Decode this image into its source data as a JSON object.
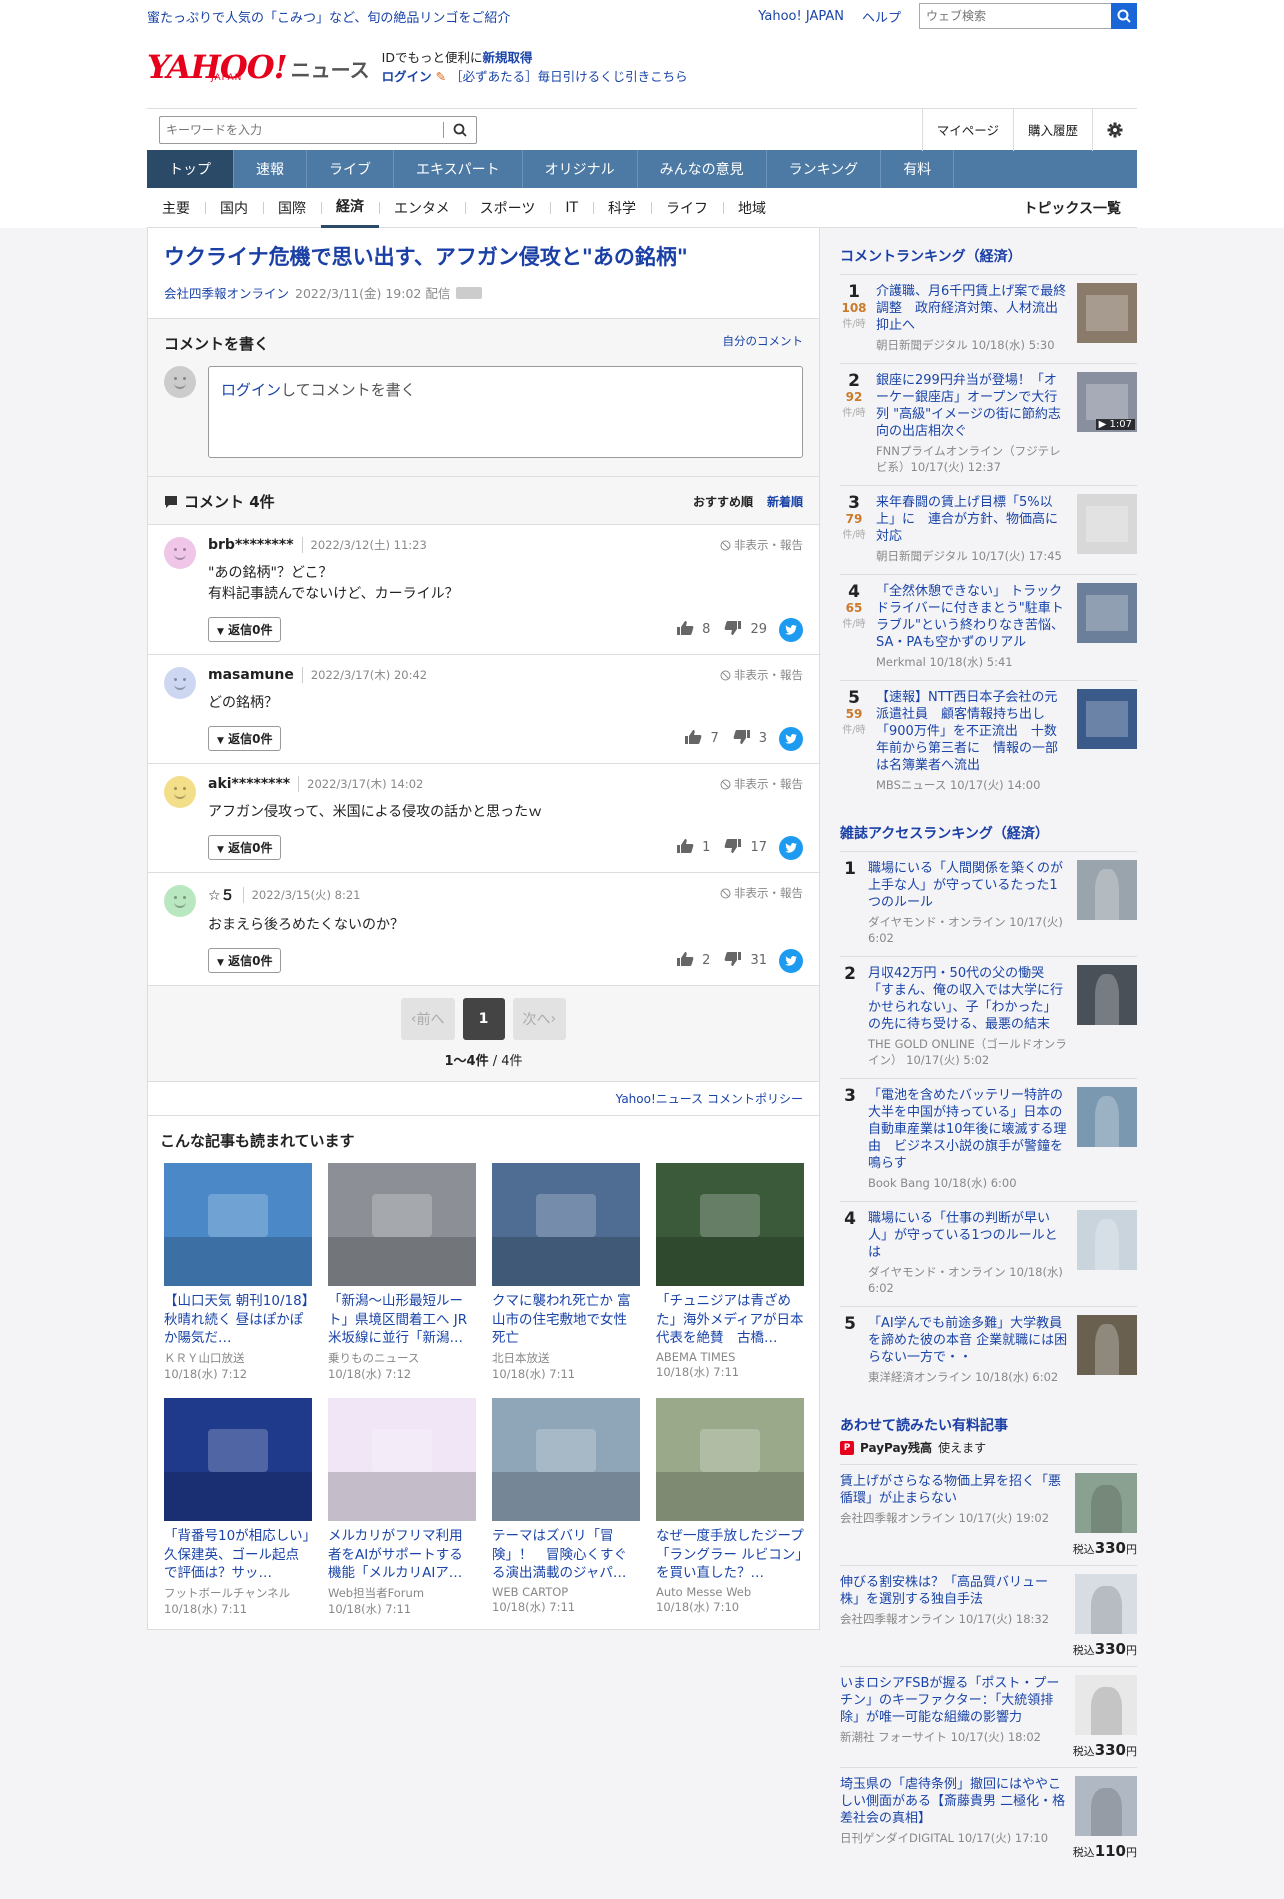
{
  "promo": {
    "ad_text": "蜜たっぷりで人気の「こみつ」など、旬の絶品リンゴをご紹介",
    "yj_link": "Yahoo! JAPAN",
    "help_link": "ヘルプ",
    "web_search_placeholder": "ウェブ検索"
  },
  "header": {
    "logo_text": "YAHOO!",
    "logo_sub": "JAPAN",
    "logo_news": "ニュース",
    "id_line_prefix": "IDでもっと便利に",
    "id_signup": "新規取得",
    "login": "ログイン",
    "lottery": "［必ずあたる］毎日引けるくじ引きこちら"
  },
  "searchbar": {
    "placeholder": "キーワードを入力",
    "mypage": "マイページ",
    "history": "購入履歴"
  },
  "nav_main": [
    "トップ",
    "速報",
    "ライブ",
    "エキスパート",
    "オリジナル",
    "みんなの意見",
    "ランキング",
    "有料"
  ],
  "nav_sub": [
    "主要",
    "国内",
    "国際",
    "経済",
    "エンタメ",
    "スポーツ",
    "IT",
    "科学",
    "ライフ",
    "地域"
  ],
  "nav_topics": "トピックス一覧",
  "article": {
    "title": "ウクライナ危機で思い出す、アフガン侵攻と\"あの銘柄\"",
    "source": "会社四季報オンライン",
    "date": "2022/3/11(金) 19:02 配信"
  },
  "comment_write": {
    "heading": "コメントを書く",
    "my_comments": "自分のコメント",
    "login_link": "ログイン",
    "prompt": "してコメントを書く"
  },
  "comments_header": {
    "title": "コメント 4件",
    "sort_recommended": "おすすめ順",
    "sort_new": "新着順"
  },
  "comments": [
    {
      "user": "brb********",
      "date": "2022/3/12(土) 11:23",
      "hide": "非表示・報告",
      "text1": "\"あの銘柄\"？どこ？",
      "text2": "有料記事読んでないけど、カーライル？",
      "reply": "返信0件",
      "good": "8",
      "bad": "29",
      "color": "#f0c6e8"
    },
    {
      "user": "masamune",
      "date": "2022/3/17(木) 20:42",
      "hide": "非表示・報告",
      "text1": "どの銘柄？",
      "text2": "",
      "reply": "返信0件",
      "good": "7",
      "bad": "3",
      "color": "#cdd7f2"
    },
    {
      "user": "aki********",
      "date": "2022/3/17(木) 14:02",
      "hide": "非表示・報告",
      "text1": "アフガン侵攻って、米国による侵攻の話かと思ったｗ",
      "text2": "",
      "reply": "返信0件",
      "good": "1",
      "bad": "17",
      "color": "#f3de8a"
    },
    {
      "user": "☆５",
      "date": "2022/3/15(火) 8:21",
      "hide": "非表示・報告",
      "text1": "おまえら後ろめたくないのか？",
      "text2": "",
      "reply": "返信0件",
      "good": "2",
      "bad": "31",
      "color": "#b9e8c0"
    }
  ],
  "pagination": {
    "prev": "前へ",
    "current": "1",
    "next": "次へ",
    "count": "1〜4件",
    "total": " / 4件"
  },
  "policy": "Yahoo!ニュース コメントポリシー",
  "related": {
    "heading": "こんな記事も読まれています",
    "items": [
      {
        "title": "【山口天気 朝刊10/18】秋晴れ続く 昼はぽかぽか陽気だ…",
        "src": "ＫＲＹ山口放送",
        "date": "10/18(水) 7:12",
        "bg": "#4a88c8"
      },
      {
        "title": "「新潟～山形最短ルート」県境区間着工へ JR米坂線に並行「新潟…",
        "src": "乗りものニュース",
        "date": "10/18(水) 7:12",
        "bg": "#8c9096"
      },
      {
        "title": "クマに襲われ死亡か 富山市の住宅敷地で女性死亡",
        "src": "北日本放送",
        "date": "10/18(水) 7:11",
        "bg": "#4f6d92"
      },
      {
        "title": "「チュニジアは青ざめた」海外メディアが日本代表を絶賛　古橋…",
        "src": "ABEMA TIMES",
        "date": "10/18(水) 7:11",
        "bg": "#3a5a3a"
      },
      {
        "title": "「背番号10が相応しい」久保建英、ゴール起点で評価は？サッ…",
        "src": "フットボールチャンネル",
        "date": "10/18(水) 7:11",
        "bg": "#1f3a8a"
      },
      {
        "title": "メルカリがフリマ利用者をAIがサポートする機能「メルカリAIア…",
        "src": "Web担当者Forum",
        "date": "10/18(水) 7:11",
        "bg": "#f1e6f6"
      },
      {
        "title": "テーマはズバリ「冒険」！　冒険心くすぐる演出満載のジャパ…",
        "src": "WEB CARTOP",
        "date": "10/18(水) 7:11",
        "bg": "#8fa5b8"
      },
      {
        "title": "なぜ一度手放したジープ「ラングラー ルビコン」を買い直した？…",
        "src": "Auto Messe Web",
        "date": "10/18(水) 7:10",
        "bg": "#9aa98a"
      }
    ]
  },
  "comment_ranking": {
    "heading": "コメントランキング（経済）",
    "unit": "件/時",
    "items": [
      {
        "rank": "1",
        "count": "108",
        "title": "介護職、月6千円賃上げ案で最終調整　政府経済対策、人材流出抑止へ",
        "src": "朝日新聞デジタル 10/18(水) 5:30",
        "bg": "#8a7a6a"
      },
      {
        "rank": "2",
        "count": "92",
        "title": "銀座に299円弁当が登場！「オーケー銀座店」オープンで大行列 \"高級\"イメージの街に節約志向の出店相次ぐ",
        "src": "FNNプライムオンライン（フジテレビ系）10/17(火) 12:37",
        "bg": "#8a8fa0",
        "badge": "▶ 1:07"
      },
      {
        "rank": "3",
        "count": "79",
        "title": "来年春闘の賃上げ目標「5%以上」に　連合が方針、物価高に対応",
        "src": "朝日新聞デジタル 10/17(火) 17:45",
        "bg": "#d8d8d8"
      },
      {
        "rank": "4",
        "count": "65",
        "title": "「全然休憩できない」 トラックドライバーに付きまとう\"駐車トラブル\"という終わりなき苦悩、SA・PAも空かずのリアル",
        "src": "Merkmal 10/18(水) 5:41",
        "bg": "#6c7f9a"
      },
      {
        "rank": "5",
        "count": "59",
        "title": "【速報】NTT西日本子会社の元派遣社員　顧客情報持ち出し「900万件」を不正流出　十数年前から第三者に　情報の一部は名簿業者へ流出",
        "src": "MBSニュース 10/17(火) 14:00",
        "bg": "#3a5a8a"
      }
    ]
  },
  "magazine_ranking": {
    "heading": "雑誌アクセスランキング（経済）",
    "items": [
      {
        "rank": "1",
        "title": "職場にいる「人間関係を築くのが上手な人」が守っているたった1つのルール",
        "src": "ダイヤモンド・オンライン 10/17(火) 6:02",
        "bg": "#9aa4ac"
      },
      {
        "rank": "2",
        "title": "月収42万円・50代の父の慟哭「すまん、俺の収入では大学に行かせられない」、子「わかった」の先に待ち受ける、最悪の結末",
        "src": "THE GOLD ONLINE（ゴールドオンライン） 10/17(火) 5:02",
        "bg": "#4a5058"
      },
      {
        "rank": "3",
        "title": "「電池を含めたバッテリー特許の大半を中国が持っている」日本の自動車産業は10年後に壊滅する理由　ビジネス小説の旗手が警鐘を鳴らす",
        "src": "Book Bang 10/18(水) 6:00",
        "bg": "#7a98b0"
      },
      {
        "rank": "4",
        "title": "職場にいる「仕事の判断が早い人」が守っている1つのルールとは",
        "src": "ダイヤモンド・オンライン 10/18(水) 6:02",
        "bg": "#c9d4dc"
      },
      {
        "rank": "5",
        "title": "「AI学んでも前途多難」大学教員を諦めた彼の本音 企業就職には困らない一方で・・",
        "src": "東洋経済オンライン 10/18(水) 6:02",
        "bg": "#6a6050"
      }
    ]
  },
  "paid": {
    "heading": "あわせて読みたい有料記事",
    "paypay": "PayPay残高",
    "paypay_suffix": "使えます",
    "tax": "税込",
    "yen": "円",
    "items": [
      {
        "title": "賃上げがさらなる物価上昇を招く「悪循環」が止まらない",
        "src": "会社四季報オンライン 10/17(火) 19:02",
        "price": "330",
        "bg": "#8aa090"
      },
      {
        "title": "伸びる割安株は？「高品質バリュー株」を選別する独自手法",
        "src": "会社四季報オンライン 10/17(火) 18:32",
        "price": "330",
        "bg": "#d8dde4"
      },
      {
        "title": "いまロシアFSBが握る「ポスト・プーチン」のキーファクター：「大統領排除」が唯一可能な組織の影響力",
        "src": "新潮社 フォーサイト 10/17(火) 18:02",
        "price": "330",
        "bg": "#e8e8e8"
      },
      {
        "title": "埼玉県の「虐待条例」撤回にはややこしい側面がある【斎藤貴男 二極化・格差社会の真相】",
        "src": "日刊ゲンダイDIGITAL 10/17(火) 17:10",
        "price": "110",
        "bg": "#b0b8c4"
      }
    ]
  }
}
